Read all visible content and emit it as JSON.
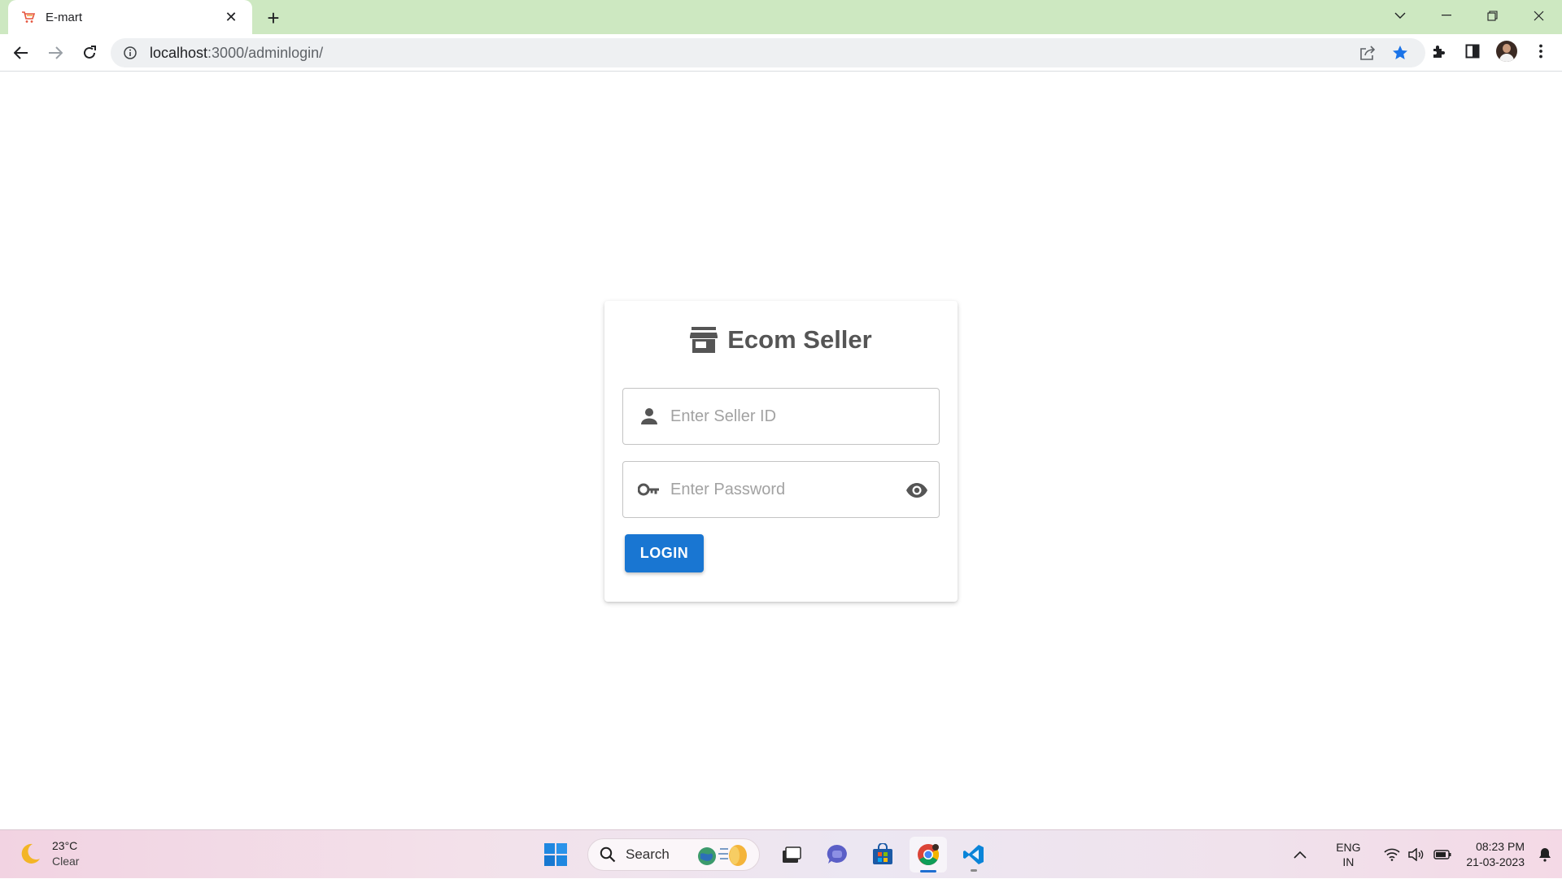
{
  "browser": {
    "tab": {
      "title": "E-mart",
      "close_label": "✕"
    },
    "new_tab_label": "+",
    "url": {
      "host": "localhost",
      "rest": ":3000/adminlogin/"
    }
  },
  "login": {
    "title": "Ecom Seller",
    "seller_id_placeholder": "Enter Seller ID",
    "password_placeholder": "Enter Password",
    "login_label": "LOGIN",
    "accent": "#1976d2"
  },
  "taskbar": {
    "weather": {
      "temp": "23°C",
      "condition": "Clear"
    },
    "search_label": "Search",
    "lang": {
      "line1": "ENG",
      "line2": "IN"
    },
    "clock": {
      "time": "08:23 PM",
      "date": "21-03-2023"
    }
  }
}
